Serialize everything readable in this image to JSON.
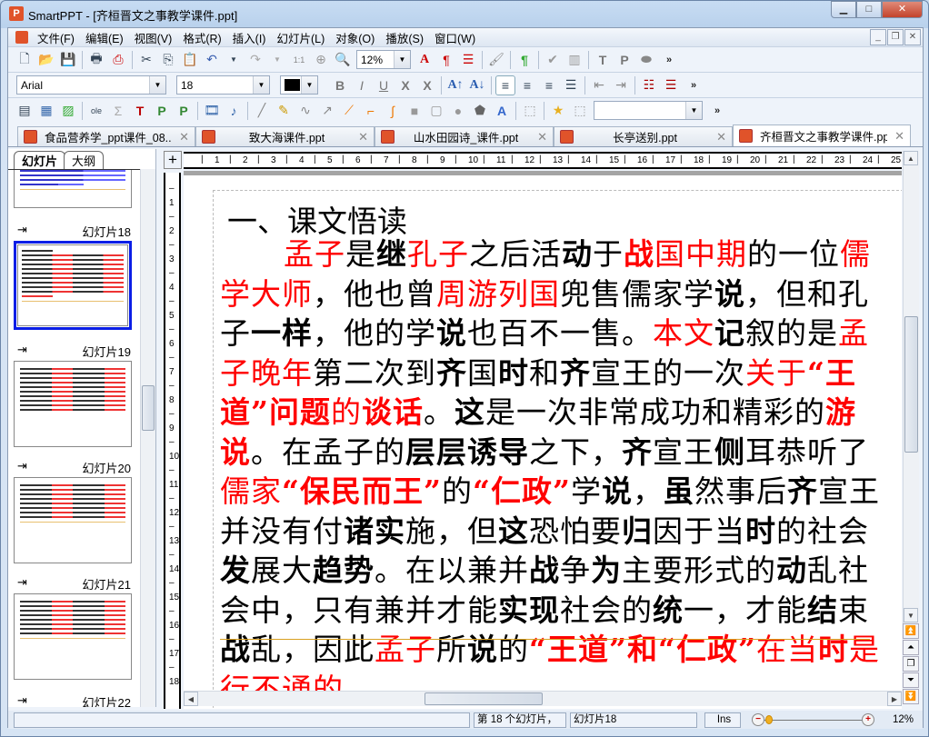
{
  "window": {
    "title": "SmartPPT - [齐桓晋文之事教学课件.ppt]",
    "app_icon": "P"
  },
  "menu": [
    "文件(F)",
    "编辑(E)",
    "视图(V)",
    "格式(R)",
    "插入(I)",
    "幻灯片(L)",
    "对象(O)",
    "播放(S)",
    "窗口(W)"
  ],
  "toolbar": {
    "zoom_value": "12%",
    "font_name": "Arial",
    "font_size": "18",
    "color_hex": "#000000",
    "more": "»",
    "shape_combo": ""
  },
  "doc_tabs": [
    {
      "label": "食品营养学_ppt课件_08...",
      "active": false
    },
    {
      "label": "致大海课件.ppt",
      "active": false
    },
    {
      "label": "山水田园诗_课件.ppt",
      "active": false
    },
    {
      "label": "长亭送别.ppt",
      "active": false
    },
    {
      "label": "齐桓晋文之事教学课件.ppt",
      "active": true
    }
  ],
  "panel_tabs": [
    "幻灯片",
    "大纲"
  ],
  "thumbnails": [
    {
      "label": "",
      "selected": false
    },
    {
      "label": "幻灯片18",
      "selected": true
    },
    {
      "label": "幻灯片19",
      "selected": false
    },
    {
      "label": "幻灯片20",
      "selected": false
    },
    {
      "label": "幻灯片21",
      "selected": false
    },
    {
      "label": "幻灯片22",
      "selected": false
    }
  ],
  "ruler_h": [
    "1",
    "2",
    "3",
    "4",
    "5",
    "6",
    "7",
    "8",
    "9",
    "10",
    "11",
    "12",
    "13",
    "14",
    "15",
    "16",
    "17",
    "18",
    "19",
    "20",
    "21",
    "22",
    "23",
    "24",
    "25"
  ],
  "ruler_v": [
    "1",
    "2",
    "3",
    "4",
    "5",
    "6",
    "7",
    "8",
    "9",
    "10",
    "11",
    "12",
    "13",
    "14",
    "15",
    "16",
    "17",
    "18"
  ],
  "slide": {
    "title": "一、课文悟读",
    "segments": [
      [
        "孟子",
        "r"
      ],
      [
        "是",
        ""
      ],
      [
        "继",
        "b"
      ],
      [
        "孔子",
        "r"
      ],
      [
        "之后活",
        ""
      ],
      [
        "动",
        "b"
      ],
      [
        "于",
        ""
      ],
      [
        "战",
        "rb"
      ],
      [
        "国中期",
        "r"
      ],
      [
        "的一位",
        ""
      ],
      [
        "儒学大师",
        "r"
      ],
      [
        "，他也曾",
        ""
      ],
      [
        "周游列国",
        "r"
      ],
      [
        "兜售儒家学",
        ""
      ],
      [
        "说",
        "b"
      ],
      [
        "，但和孔子",
        ""
      ],
      [
        "一样",
        "b"
      ],
      [
        "，他的学",
        ""
      ],
      [
        "说",
        "b"
      ],
      [
        "也百不一售。",
        ""
      ],
      [
        "本文",
        "r"
      ],
      [
        "记",
        "b"
      ],
      [
        "叙的是",
        ""
      ],
      [
        "孟子晚年",
        "r"
      ],
      [
        "第二次到",
        ""
      ],
      [
        "齐",
        "b"
      ],
      [
        "国",
        ""
      ],
      [
        "时",
        "b"
      ],
      [
        "和",
        ""
      ],
      [
        "齐",
        "b"
      ],
      [
        "宣王的一次",
        ""
      ],
      [
        "关于",
        "r"
      ],
      [
        "“王道”问题",
        "rb"
      ],
      [
        "的",
        "r"
      ],
      [
        "谈话",
        "rb"
      ],
      [
        "。",
        ""
      ],
      [
        "这",
        "b"
      ],
      [
        "是一次非常成功和精彩的",
        ""
      ],
      [
        "游说",
        "rb"
      ],
      [
        "。在孟子的",
        ""
      ],
      [
        "层层诱导",
        "b"
      ],
      [
        "之下，",
        ""
      ],
      [
        "齐",
        "b"
      ],
      [
        "宣王",
        ""
      ],
      [
        "侧",
        "b"
      ],
      [
        "耳恭听了",
        ""
      ],
      [
        "儒家",
        "r"
      ],
      [
        "“保民而王”",
        "rb"
      ],
      [
        "的",
        ""
      ],
      [
        "“仁政”",
        "rb"
      ],
      [
        "学",
        ""
      ],
      [
        "说",
        "b"
      ],
      [
        "，",
        ""
      ],
      [
        "虽",
        "b"
      ],
      [
        "然事后",
        ""
      ],
      [
        "齐",
        "b"
      ],
      [
        "宣王并没有付",
        ""
      ],
      [
        "诸实",
        "b"
      ],
      [
        "施，但",
        ""
      ],
      [
        "这",
        "b"
      ],
      [
        "恐怕要",
        ""
      ],
      [
        "归",
        "b"
      ],
      [
        "因于当",
        ""
      ],
      [
        "时",
        "b"
      ],
      [
        "的社会",
        ""
      ],
      [
        "发",
        "b"
      ],
      [
        "展大",
        ""
      ],
      [
        "趋势",
        "b"
      ],
      [
        "。在以兼并",
        ""
      ],
      [
        "战",
        "b"
      ],
      [
        "争",
        ""
      ],
      [
        "为",
        "b"
      ],
      [
        "主要形式的",
        ""
      ],
      [
        "动",
        "b"
      ],
      [
        "乱社会中，只有兼并才能",
        ""
      ],
      [
        "实现",
        "b"
      ],
      [
        "社会的",
        ""
      ],
      [
        "统",
        "b"
      ],
      [
        "一，才能",
        ""
      ],
      [
        "结",
        "b"
      ],
      [
        "束",
        ""
      ],
      [
        "战",
        "b"
      ],
      [
        "乱，因此",
        ""
      ],
      [
        "孟子",
        "r"
      ],
      [
        "所",
        ""
      ],
      [
        "说",
        "b"
      ],
      [
        "的",
        ""
      ],
      [
        "“王道”和“仁政”",
        "rb"
      ],
      [
        "在当",
        "r"
      ],
      [
        "时",
        "rb"
      ],
      [
        "是行不通的。",
        "r"
      ]
    ]
  },
  "status": {
    "message": "",
    "slide_index": "第 18 个幻灯片，",
    "slide_name": "幻灯片18",
    "mode": "Ins",
    "zoom": "12%",
    "zoom_fraction": 0.03
  },
  "colors": {
    "accent_red": "#ff0000",
    "selection_blue": "#0a1ee6"
  }
}
